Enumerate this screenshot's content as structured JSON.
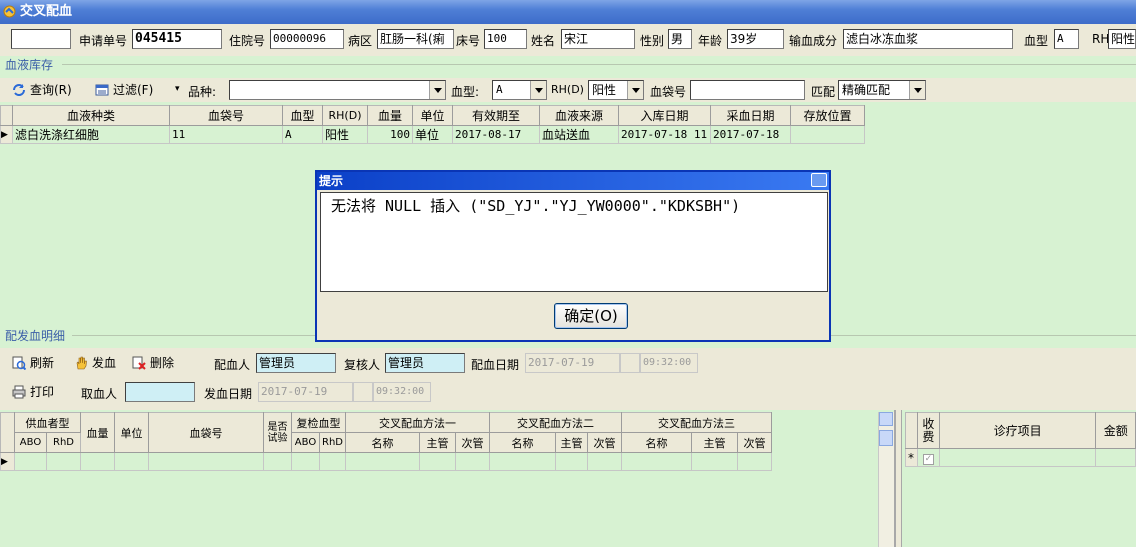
{
  "window": {
    "title": "交叉配血"
  },
  "patient": {
    "blank_value": "",
    "req_label": "申请单号",
    "req_value": "045415",
    "inpatient_label": "住院号",
    "inpatient_value": "00000096",
    "ward_label": "病区",
    "ward_value": "肛肠一科(痢",
    "bed_label": "床号",
    "bed_value": "100",
    "name_label": "姓名",
    "name_value": "宋江",
    "sex_label": "性别",
    "sex_value": "男",
    "age_label": "年龄",
    "age_value": "39岁",
    "component_label": "输血成分",
    "component_value": "滤白冰冻血浆",
    "bloodtype_label": "血型",
    "bloodtype_value": "A",
    "rh_label": "RH",
    "rh_value": "阳性"
  },
  "stock": {
    "section_title": "血液库存",
    "query_label": "查询(R)",
    "filter_label": "过滤(F)",
    "variety_label": "品种:",
    "variety_value": "",
    "bloodtype_label": "血型:",
    "bloodtype_value": "A",
    "rh_label": "RH(D)",
    "rh_value": "阳性",
    "bagno_label": "血袋号",
    "bagno_value": "",
    "match_label": "匹配",
    "match_value": "精确匹配",
    "columns": [
      "血液种类",
      "血袋号",
      "血型",
      "RH(D)",
      "血量",
      "单位",
      "有效期至",
      "血液来源",
      "入库日期",
      "采血日期",
      "存放位置"
    ],
    "rows": [
      [
        "滤白洗涤红细胞",
        "11",
        "A",
        "阳性",
        "100",
        "单位",
        "2017-08-17",
        "血站送血",
        "2017-07-18 11",
        "2017-07-18",
        ""
      ]
    ]
  },
  "dialog": {
    "title": "提示",
    "message": "无法将 NULL 插入 (\"SD_YJ\".\"YJ_YW0000\".\"KDKSBH\")",
    "ok_label": "确定(O)"
  },
  "detail": {
    "section_title": "配发血明细",
    "refresh_label": "刷新",
    "issue_label": "发血",
    "delete_label": "删除",
    "matcher_label": "配血人",
    "matcher_value": "管理员",
    "checker_label": "复核人",
    "checker_value": "管理员",
    "match_date_label": "配血日期",
    "match_date_value": "2017-07-19",
    "match_time_value": "09:32:00",
    "print_label": "打印",
    "taker_label": "取血人",
    "taker_value": "",
    "issue_date_label": "发血日期",
    "issue_date_value": "2017-07-19",
    "issue_time_value": "09:32:00",
    "grid": {
      "donor_type": "供血者型",
      "abo": "ABO",
      "rhd": "RhD",
      "volume": "血量",
      "unit": "单位",
      "bagno": "血袋号",
      "trial_line1": "是否",
      "trial_line2": "试验",
      "recheck": "复检血型",
      "abo2": "ABO",
      "rhd2": "RhD",
      "method1": "交叉配血方法一",
      "method2": "交叉配血方法二",
      "method3": "交叉配血方法三",
      "name": "名称",
      "main": "主管",
      "minor": "次管"
    },
    "fee": {
      "charged_line1": "收",
      "charged_line2": "费",
      "item": "诊疗项目",
      "amount": "金额",
      "new_row_marker": "*"
    }
  }
}
